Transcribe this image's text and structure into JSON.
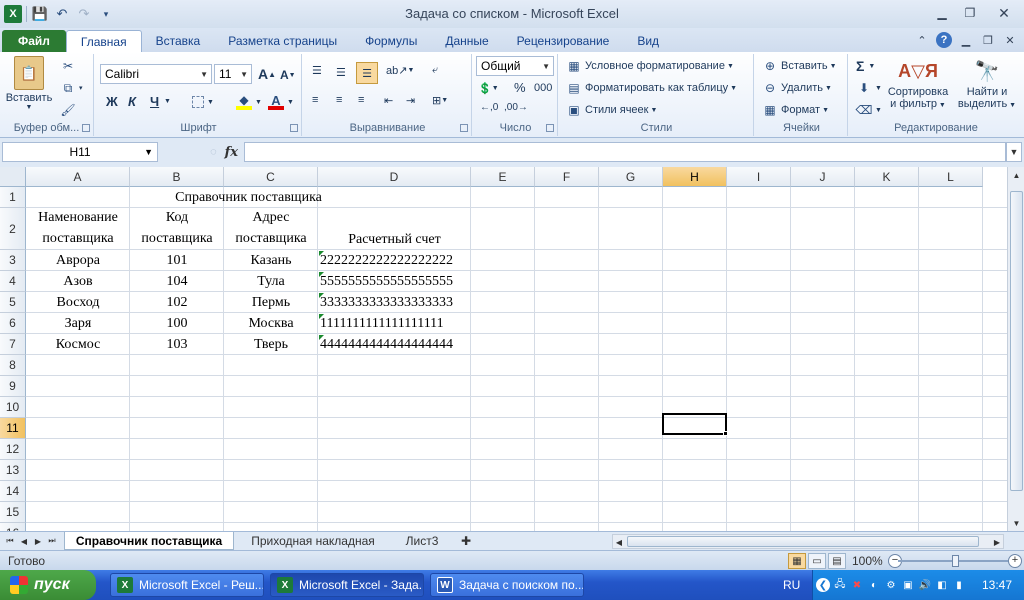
{
  "window": {
    "title": "Задача со списком  -  Microsoft Excel",
    "app_icon": "X"
  },
  "tabs": [
    {
      "label": "Файл"
    },
    {
      "label": "Главная"
    },
    {
      "label": "Вставка"
    },
    {
      "label": "Разметка страницы"
    },
    {
      "label": "Формулы"
    },
    {
      "label": "Данные"
    },
    {
      "label": "Рецензирование"
    },
    {
      "label": "Вид"
    }
  ],
  "ribbon": {
    "clipboard": {
      "paste_label": "Вставить",
      "group_label": "Буфер обм..."
    },
    "font": {
      "font_name": "Calibri",
      "font_size": "11",
      "bold": "Ж",
      "italic": "К",
      "underline": "Ч",
      "group_label": "Шрифт"
    },
    "alignment": {
      "group_label": "Выравнивание"
    },
    "number": {
      "format": "Общий",
      "percent": "%",
      "thousands": "000",
      "group_label": "Число"
    },
    "styles": {
      "conditional": "Условное форматирование",
      "as_table": "Форматировать как таблицу",
      "cell_styles": "Стили ячеек",
      "group_label": "Стили"
    },
    "cells": {
      "insert": "Вставить",
      "delete": "Удалить",
      "format": "Формат",
      "group_label": "Ячейки"
    },
    "editing": {
      "sigma": "Σ",
      "sort_line1": "Сортировка",
      "sort_line2": "и фильтр",
      "find_line1": "Найти и",
      "find_line2": "выделить",
      "group_label": "Редактирование"
    }
  },
  "formula_bar": {
    "name_box": "H11",
    "fx": "fx",
    "value": ""
  },
  "grid": {
    "columns": [
      "A",
      "B",
      "C",
      "D",
      "E",
      "F",
      "G",
      "H",
      "I",
      "J",
      "K",
      "L"
    ],
    "rows": [
      "1",
      "2",
      "3",
      "4",
      "5",
      "6",
      "7",
      "8",
      "9",
      "10",
      "11",
      "12",
      "13",
      "14",
      "15",
      "16"
    ],
    "selected_column": "H",
    "selected_row": "11",
    "title": "Справочник поставщика",
    "headers": {
      "name_l1": "Наменование",
      "name_l2": "поставщика",
      "code_l1": "Код",
      "code_l2": "поставщика",
      "addr_l1": "Адрес",
      "addr_l2": "поставщика",
      "account": "Расчетный счет"
    },
    "data": [
      {
        "name": "Аврора",
        "code": "101",
        "city": "Казань",
        "account": "2222222222222222222"
      },
      {
        "name": "Азов",
        "code": "104",
        "city": "Тула",
        "account": "5555555555555555555"
      },
      {
        "name": "Восход",
        "code": "102",
        "city": "Пермь",
        "account": "3333333333333333333"
      },
      {
        "name": "Заря",
        "code": "100",
        "city": "Москва",
        "account": "1111111111111111111"
      },
      {
        "name": "Космос",
        "code": "103",
        "city": "Тверь",
        "account": "4444444444444444444"
      }
    ]
  },
  "sheets": [
    {
      "label": "Справочник поставщика",
      "active": true
    },
    {
      "label": "Приходная накладная",
      "active": false
    },
    {
      "label": "Лист3",
      "active": false
    }
  ],
  "status": {
    "ready": "Готово",
    "zoom": "100%"
  },
  "taskbar": {
    "start": "пуск",
    "tasks": [
      {
        "label": "Microsoft Excel - Реш..."
      },
      {
        "label": "Microsoft Excel - Зада..."
      },
      {
        "label": "Задача с поиском по..."
      }
    ],
    "lang": "RU",
    "clock": "13:47"
  }
}
